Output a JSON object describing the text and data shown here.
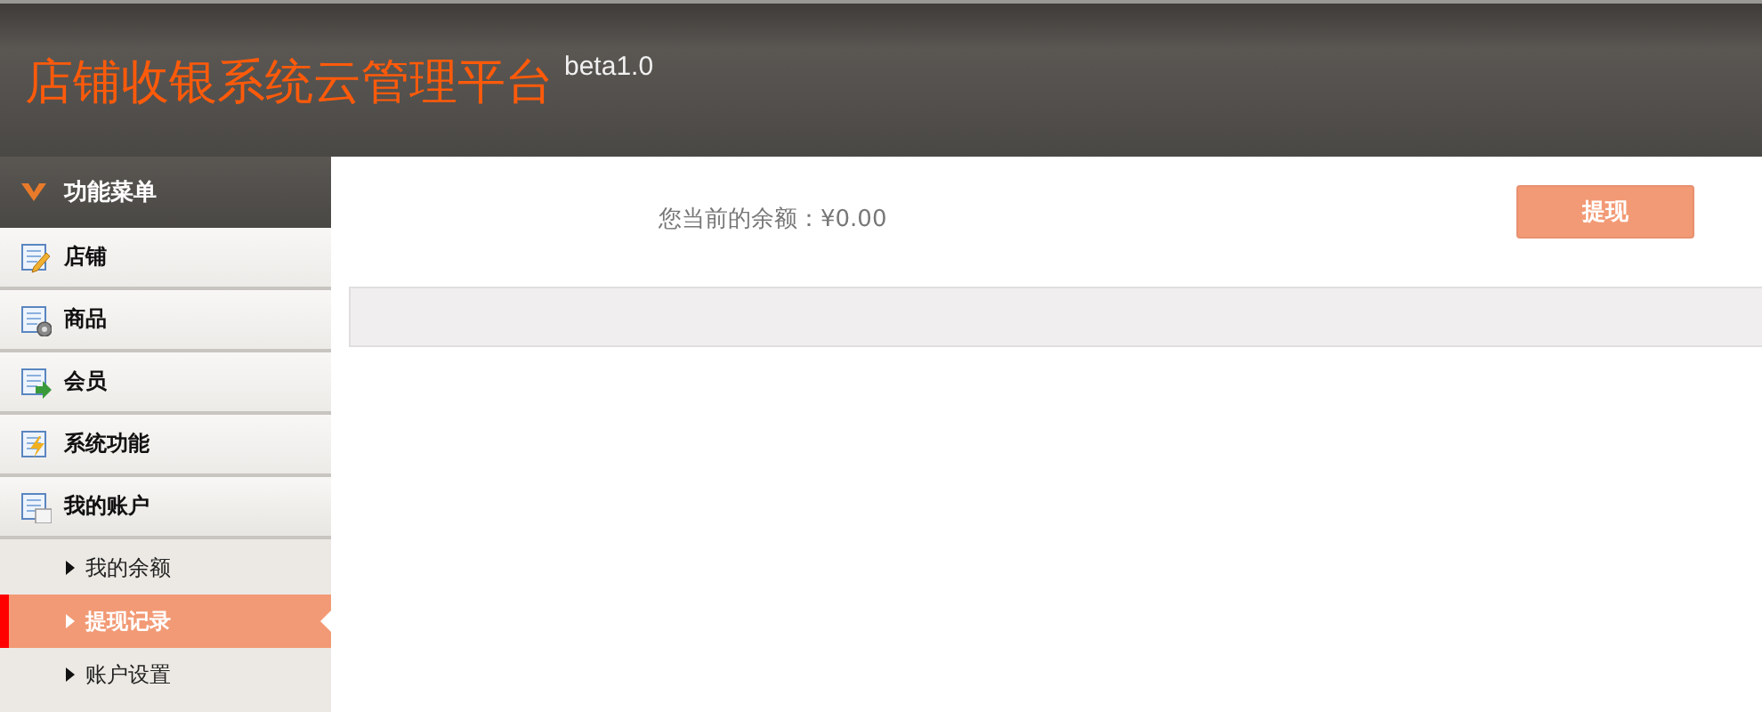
{
  "header": {
    "title": "店铺收银系统云管理平台",
    "version": "beta1.0"
  },
  "sidebar": {
    "title": "功能菜单",
    "items": [
      {
        "label": "店铺"
      },
      {
        "label": "商品"
      },
      {
        "label": "会员"
      },
      {
        "label": "系统功能"
      },
      {
        "label": "我的账户",
        "children": [
          {
            "label": "我的余额",
            "selected": false
          },
          {
            "label": "提现记录",
            "selected": true
          },
          {
            "label": "账户设置",
            "selected": false
          }
        ]
      }
    ]
  },
  "main": {
    "balance": "您当前的余额：¥0.00",
    "withdraw_button": "提现"
  }
}
